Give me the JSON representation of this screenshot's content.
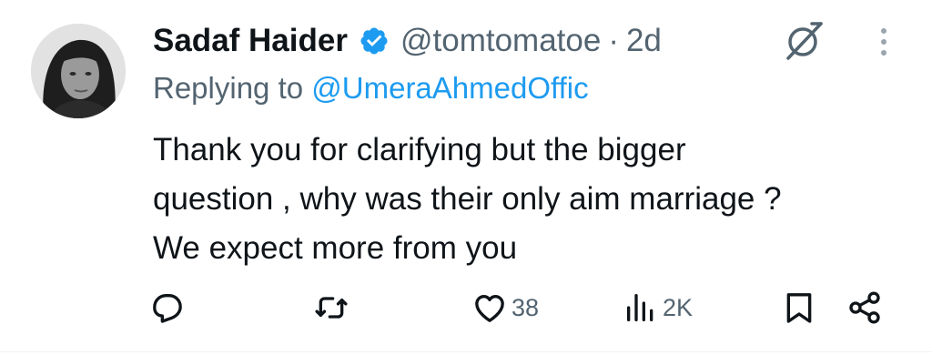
{
  "tweet": {
    "author": {
      "name": "Sadaf Haider",
      "handle": "@tomtomatoe",
      "verified": true
    },
    "separator": "·",
    "time": "2d",
    "reply": {
      "prefix": "Replying to ",
      "mention": "@UmeraAhmedOffic"
    },
    "text_lines": [
      "Thank you for clarifying but the bigger",
      "question , why was their only aim marriage ?",
      "We expect more from you"
    ],
    "actions": {
      "reply_icon": "reply-icon",
      "retweet_icon": "retweet-icon",
      "like_icon": "heart-icon",
      "likes": "38",
      "views_icon": "views-icon",
      "views": "2K",
      "bookmark_icon": "bookmark-icon",
      "share_icon": "share-icon"
    }
  },
  "colors": {
    "primary_text": "#0f1419",
    "secondary_text": "#536471",
    "link": "#1d9bf0",
    "verified_badge": "#1d9bf0"
  }
}
